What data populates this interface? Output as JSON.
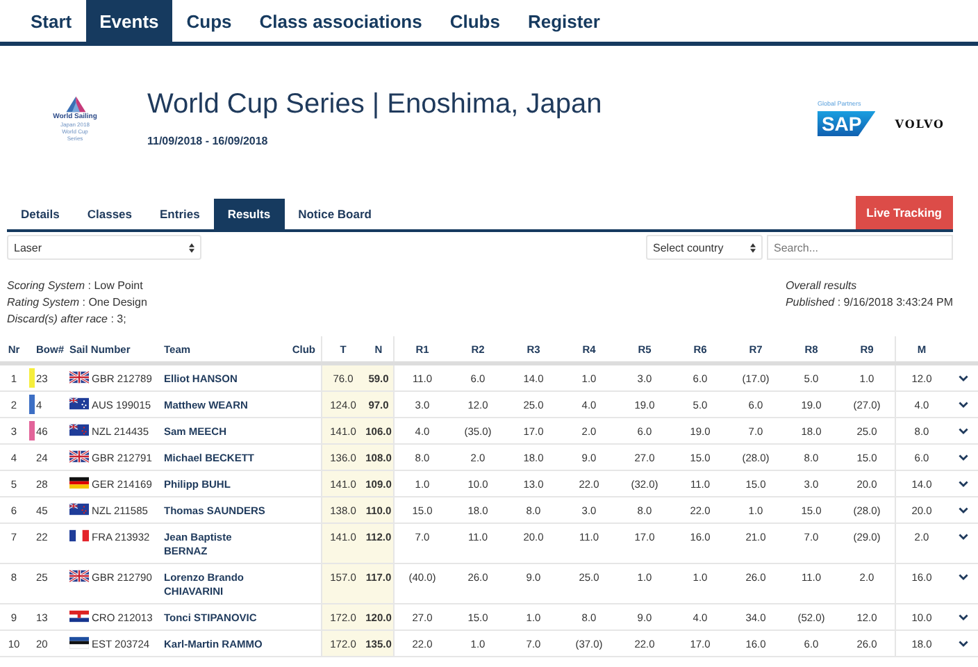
{
  "nav": [
    {
      "label": "Start",
      "selected": false
    },
    {
      "label": "Events",
      "selected": true
    },
    {
      "label": "Cups",
      "selected": false
    },
    {
      "label": "Class associations",
      "selected": false
    },
    {
      "label": "Clubs",
      "selected": false
    },
    {
      "label": "Register",
      "selected": false
    }
  ],
  "header": {
    "logo_lines": [
      "World Sailing",
      "Japan 2018",
      "World Cup",
      "Series"
    ],
    "title": "World Cup Series | Enoshima, Japan",
    "dates": "11/09/2018 - 16/09/2018",
    "partners_label": "Global Partners",
    "sponsors": [
      "SAP",
      "VOLVO"
    ]
  },
  "subtabs": [
    {
      "label": "Details",
      "selected": false
    },
    {
      "label": "Classes",
      "selected": false
    },
    {
      "label": "Entries",
      "selected": false
    },
    {
      "label": "Results",
      "selected": true
    },
    {
      "label": "Notice Board",
      "selected": false
    }
  ],
  "live_tracking": "Live Tracking",
  "class_select": "Laser",
  "country_select": "Select country",
  "search": {
    "placeholder": "Search..."
  },
  "info": [
    {
      "label": "Scoring System",
      "value": ": Low Point"
    },
    {
      "label": "Rating System",
      "value": ": One Design"
    },
    {
      "label": "Discard(s) after race",
      "value": ": 3;"
    }
  ],
  "overall": {
    "title": "Overall results",
    "label": "Published",
    "value": ": 9/16/2018 3:43:24 PM"
  },
  "table": {
    "columns": [
      "Nr",
      "Bow#",
      "Sail Number",
      "Team",
      "Club",
      "T",
      "N",
      "R1",
      "R2",
      "R3",
      "R4",
      "R5",
      "R6",
      "R7",
      "R8",
      "R9",
      "M"
    ],
    "rows": [
      {
        "nr": "1",
        "color": "#f5ee3c",
        "bow": "23",
        "kind": "gbr",
        "sail": "GBR 212789",
        "team": "Elliot HANSON",
        "t": "76.0",
        "n": "59.0",
        "races": [
          "11.0",
          "6.0",
          "14.0",
          "1.0",
          "3.0",
          "6.0",
          "(17.0)",
          "5.0",
          "1.0"
        ],
        "m": "12.0"
      },
      {
        "nr": "2",
        "color": "#3d6fc4",
        "bow": "4",
        "kind": "aus",
        "sail": "AUS 199015",
        "team": "Matthew WEARN",
        "t": "124.0",
        "n": "97.0",
        "races": [
          "3.0",
          "12.0",
          "25.0",
          "4.0",
          "19.0",
          "5.0",
          "6.0",
          "19.0",
          "(27.0)"
        ],
        "m": "4.0"
      },
      {
        "nr": "3",
        "color": "#e2649a",
        "bow": "46",
        "kind": "nzl",
        "sail": "NZL 214435",
        "team": "Sam MEECH",
        "t": "141.0",
        "n": "106.0",
        "races": [
          "4.0",
          "(35.0)",
          "17.0",
          "2.0",
          "6.0",
          "19.0",
          "7.0",
          "18.0",
          "25.0"
        ],
        "m": "8.0"
      },
      {
        "nr": "4",
        "bow": "24",
        "kind": "gbr",
        "sail": "GBR 212791",
        "team": "Michael BECKETT",
        "t": "136.0",
        "n": "108.0",
        "races": [
          "8.0",
          "2.0",
          "18.0",
          "9.0",
          "27.0",
          "15.0",
          "(28.0)",
          "8.0",
          "15.0"
        ],
        "m": "6.0"
      },
      {
        "nr": "5",
        "bow": "28",
        "kind": "ger",
        "sail": "GER 214169",
        "team": "Philipp BUHL",
        "t": "141.0",
        "n": "109.0",
        "races": [
          "1.0",
          "10.0",
          "13.0",
          "22.0",
          "(32.0)",
          "11.0",
          "15.0",
          "3.0",
          "20.0"
        ],
        "m": "14.0"
      },
      {
        "nr": "6",
        "bow": "45",
        "kind": "nzl",
        "sail": "NZL 211585",
        "team": "Thomas SAUNDERS",
        "t": "138.0",
        "n": "110.0",
        "races": [
          "15.0",
          "18.0",
          "8.0",
          "3.0",
          "8.0",
          "22.0",
          "1.0",
          "15.0",
          "(28.0)"
        ],
        "m": "20.0"
      },
      {
        "nr": "7",
        "bow": "22",
        "kind": "fra",
        "sail": "FRA 213932",
        "team": "Jean Baptiste BERNAZ",
        "t": "141.0",
        "n": "112.0",
        "races": [
          "7.0",
          "11.0",
          "20.0",
          "11.0",
          "17.0",
          "16.0",
          "21.0",
          "7.0",
          "(29.0)"
        ],
        "m": "2.0"
      },
      {
        "nr": "8",
        "bow": "25",
        "kind": "gbr",
        "sail": "GBR 212790",
        "team": "Lorenzo Brando CHIAVARINI",
        "t": "157.0",
        "n": "117.0",
        "races": [
          "(40.0)",
          "26.0",
          "9.0",
          "25.0",
          "1.0",
          "1.0",
          "26.0",
          "11.0",
          "2.0"
        ],
        "m": "16.0"
      },
      {
        "nr": "9",
        "bow": "13",
        "kind": "cro",
        "sail": "CRO 212013",
        "team": "Tonci STIPANOVIC",
        "t": "172.0",
        "n": "120.0",
        "races": [
          "27.0",
          "15.0",
          "1.0",
          "8.0",
          "9.0",
          "4.0",
          "34.0",
          "(52.0)",
          "12.0"
        ],
        "m": "10.0"
      },
      {
        "nr": "10",
        "bow": "20",
        "kind": "est",
        "sail": "EST 203724",
        "team": "Karl-Martin RAMMO",
        "t": "172.0",
        "n": "135.0",
        "races": [
          "22.0",
          "1.0",
          "7.0",
          "(37.0)",
          "22.0",
          "17.0",
          "16.0",
          "6.0",
          "26.0"
        ],
        "m": "18.0"
      }
    ]
  }
}
